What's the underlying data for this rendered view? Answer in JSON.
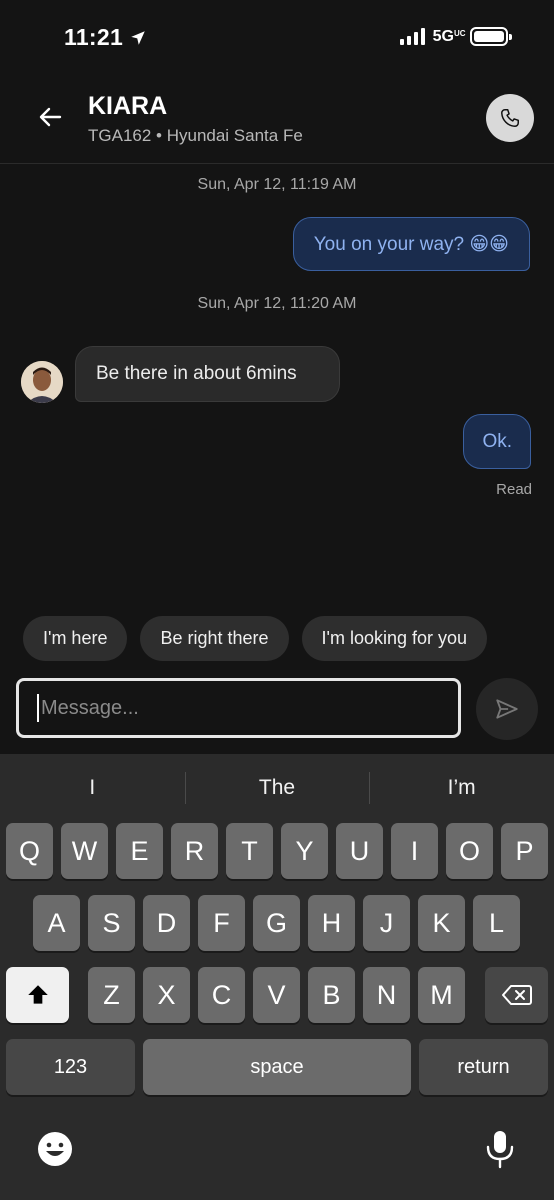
{
  "status_bar": {
    "time": "11:21",
    "network": "5G",
    "network_suffix": "UC"
  },
  "header": {
    "contact_name": "KIARA",
    "vehicle_info": "TGA162 • Hyundai Santa Fe"
  },
  "messages": [
    {
      "type": "timestamp",
      "text": "Sun, Apr 12, 11:19 AM"
    },
    {
      "type": "outgoing",
      "text": "You on your way? 😁😁"
    },
    {
      "type": "timestamp",
      "text": "Sun, Apr 12, 11:20 AM"
    },
    {
      "type": "incoming",
      "text": "Be there in about 6mins"
    },
    {
      "type": "outgoing",
      "text": "Ok."
    }
  ],
  "read_receipt": "Read",
  "quick_replies": [
    "I'm here",
    "Be right there",
    "I'm looking for you"
  ],
  "composer": {
    "placeholder": "Message...",
    "value": ""
  },
  "keyboard": {
    "suggestions": [
      "I",
      "The",
      "I’m"
    ],
    "row1": [
      "Q",
      "W",
      "E",
      "R",
      "T",
      "Y",
      "U",
      "I",
      "O",
      "P"
    ],
    "row2": [
      "A",
      "S",
      "D",
      "F",
      "G",
      "H",
      "J",
      "K",
      "L"
    ],
    "row3": [
      "Z",
      "X",
      "C",
      "V",
      "B",
      "N",
      "M"
    ],
    "numbers_label": "123",
    "space_label": "space",
    "return_label": "return"
  },
  "colors": {
    "background": "#141414",
    "outgoing_bubble": "#1a2c4d",
    "outgoing_text": "#8fb2f0",
    "incoming_bubble": "#2a2a2a"
  }
}
